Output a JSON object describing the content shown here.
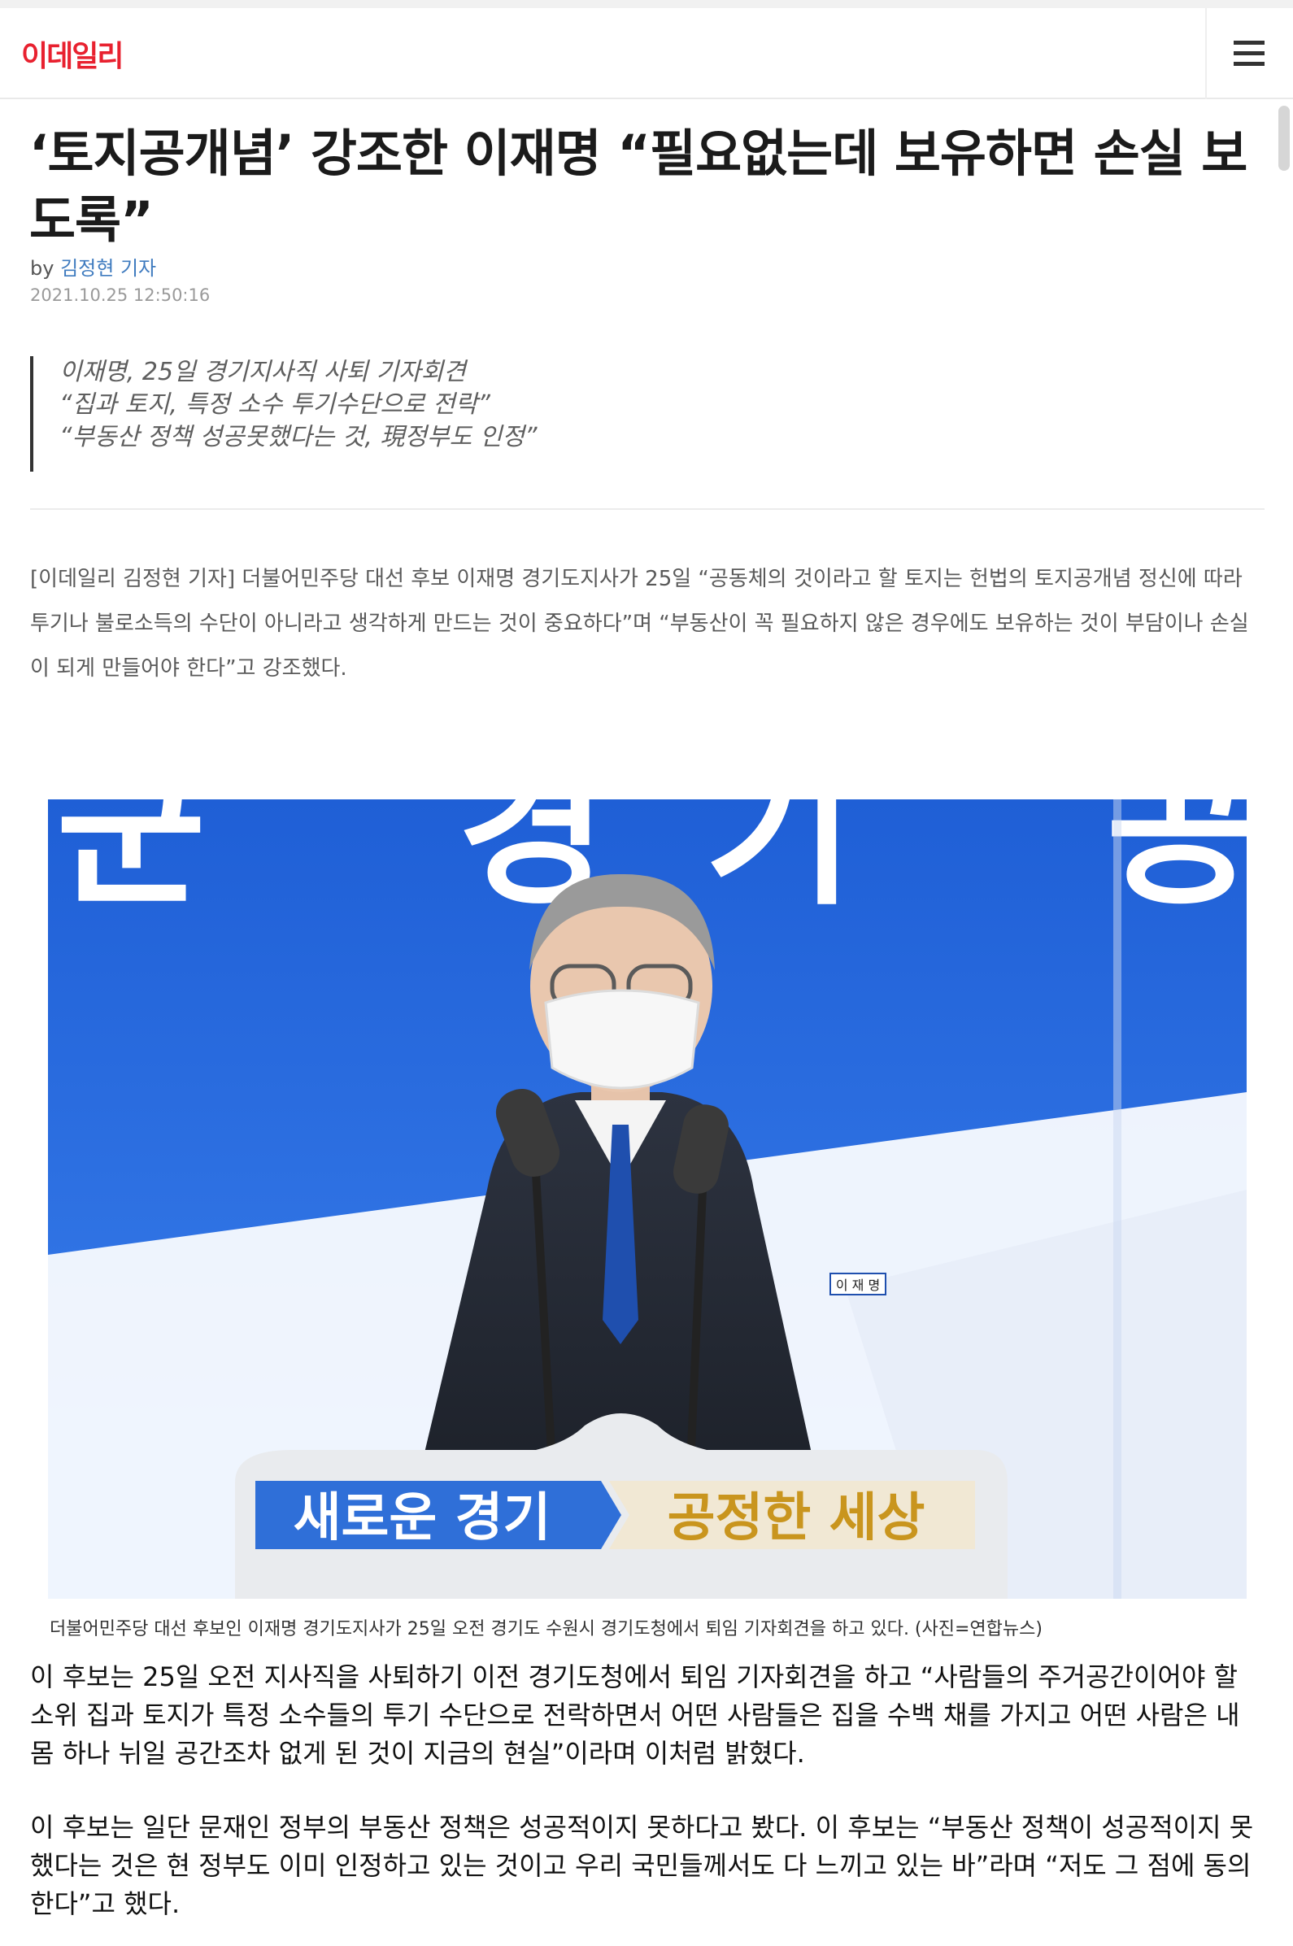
{
  "header": {
    "logo_text": "이데일리",
    "menu_icon": "hamburger-icon",
    "brand_color": "#e8212f"
  },
  "article": {
    "title": "‘토지공개념’ 강조한 이재명 “필요없는데 보유하면 손실 보도록”",
    "byline_prefix": "by",
    "author": "김정현 기자",
    "timestamp": "2021.10.25 12:50:16",
    "summary": [
      "이재명, 25일 경기지사직 사퇴 기자회견",
      "“집과 토지, 특정 소수 투기수단으로 전락”",
      "“부동산 정책 성공못했다는 것, 現정부도 인정”"
    ],
    "lead": "[이데일리 김정현 기자] 더불어민주당 대선 후보 이재명 경기도지사가 25일 “공동체의 것이라고 할 토지는 헌법의 토지공개념 정신에 따라 투기나 불로소득의 수단이 아니라고 생각하게 만드는 것이 중요하다”며 “부동산이 꼭 필요하지 않은 경우에도 보유하는 것이 부담이나 손실이 되게 만들어야 한다”고 강조했다.",
    "photo": {
      "backdrop_text": "군 경기 공",
      "podium_left": "새로운 경기",
      "podium_right": "공정한 세상",
      "nameplate": "이 재 명",
      "caption": "더불어민주당 대선 후보인 이재명 경기도지사가 25일 오전 경기도 수원시 경기도청에서 퇴임 기자회견을 하고 있다. (사진=연합뉴스)"
    },
    "paragraphs": [
      "이 후보는 25일 오전 지사직을 사퇴하기 이전 경기도청에서 퇴임 기자회견을 하고 “사람들의 주거공간이어야 할 소위 집과 토지가 특정 소수들의 투기 수단으로 전락하면서 어떤 사람들은 집을 수백 채를 가지고 어떤 사람은 내 몸 하나 뉘일 공간조차 없게 된 것이 지금의 현실”이라며 이처럼 밝혔다.",
      "이 후보는 일단 문재인 정부의 부동산 정책은 성공적이지 못하다고 봤다. 이 후보는 “부동산 정책이 성공적이지 못했다는 것은 현 정부도 이미 인정하고 있는 것이고 우리 국민들께서도 다 느끼고 있는 바”라며 “저도 그 점에 동의한다”고 했다."
    ]
  }
}
